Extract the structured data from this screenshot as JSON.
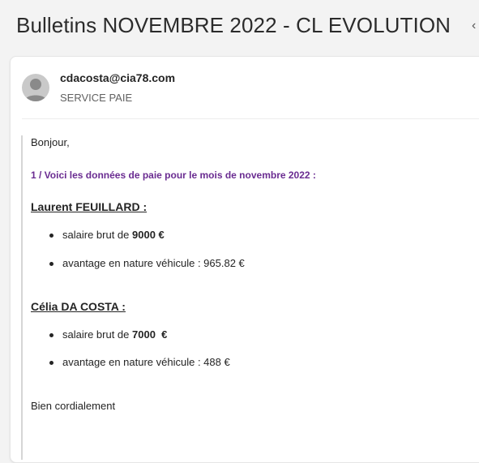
{
  "subject": "Bulletins NOVEMBRE 2022 - CL EVOLUTION",
  "header": {
    "back_icon": "chevron-left-icon"
  },
  "sender": {
    "email": "cdacosta@cia78.com",
    "organization": "SERVICE PAIE",
    "avatar_icon": "person-icon"
  },
  "body": {
    "greeting": "Bonjour,",
    "intro": "1 / Voici les données de paie pour le mois de novembre 2022 :",
    "employees": [
      {
        "name": "Laurent FEUILLARD :",
        "salary_prefix": "salaire brut de ",
        "salary_value": "9000 €",
        "benefit": "avantage en nature véhicule : 965.82 €"
      },
      {
        "name": "Célia DA COSTA :",
        "salary_prefix": "salaire brut de ",
        "salary_value": "7000  €",
        "benefit": "avantage en nature véhicule : 488 €"
      }
    ],
    "closing": "Bien cordialement"
  },
  "colors": {
    "accent_purple": "#6a2c91"
  }
}
